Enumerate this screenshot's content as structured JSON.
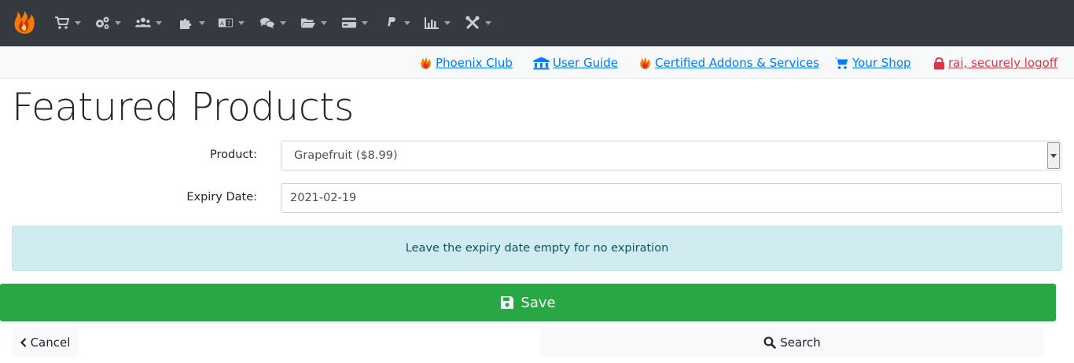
{
  "navbar": {
    "logo_icon": "phoenix-flame-icon",
    "menus": [
      {
        "icon": "cart-icon"
      },
      {
        "icon": "cogs-icon"
      },
      {
        "icon": "users-icon"
      },
      {
        "icon": "puzzle-icon"
      },
      {
        "icon": "language-icon"
      },
      {
        "icon": "comments-icon"
      },
      {
        "icon": "folder-open-icon"
      },
      {
        "icon": "credit-card-icon"
      },
      {
        "icon": "paypal-icon"
      },
      {
        "icon": "chart-bar-icon"
      },
      {
        "icon": "tools-icon"
      }
    ]
  },
  "links": {
    "phoenix_club": "Phoenix Club",
    "user_guide": "User Guide",
    "addons": "Certified Addons & Services",
    "your_shop": "Your Shop",
    "logoff": "rai, securely logoff"
  },
  "page": {
    "title": "Featured Products"
  },
  "form": {
    "product_label": "Product:",
    "product_value": "Grapefruit ($8.99)",
    "expiry_label": "Expiry Date:",
    "expiry_value": "2021-02-19"
  },
  "alert": {
    "text": "Leave the expiry date empty for no expiration"
  },
  "buttons": {
    "save": "Save",
    "cancel": "Cancel",
    "search": "Search"
  },
  "colors": {
    "navbar": "#343a40",
    "link": "#007bff",
    "danger": "#dc3545",
    "success": "#28a745",
    "info_bg": "#d1ecf1"
  }
}
